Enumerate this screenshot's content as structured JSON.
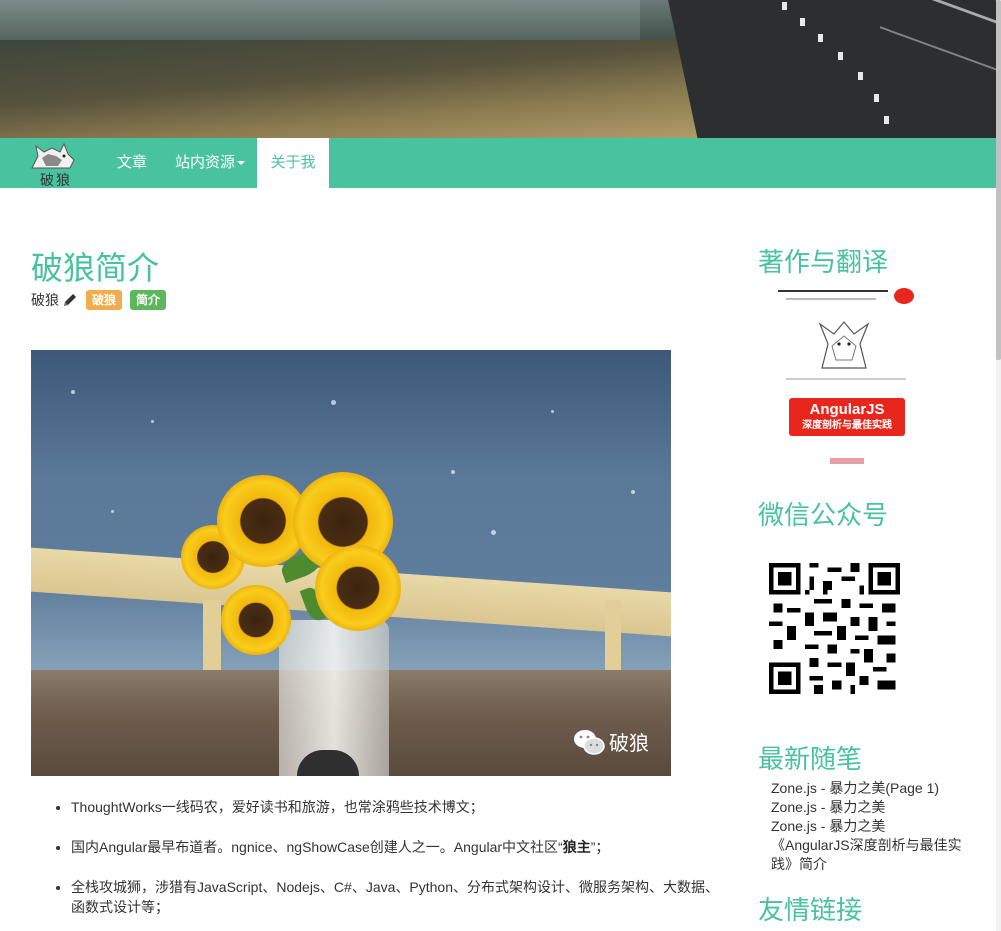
{
  "brand": {
    "logo_text": "破狼"
  },
  "nav": {
    "items": [
      {
        "label": "文章"
      },
      {
        "label": "站内资源",
        "has_dropdown": true
      },
      {
        "label": "关于我",
        "active": true
      }
    ]
  },
  "article": {
    "title": "破狼简介",
    "author": "破狼",
    "tags": [
      "破狼",
      "简介"
    ],
    "photo_watermark": "破狼",
    "bullets": [
      {
        "text_before": "ThoughtWorks一线码农，爱好读书和旅游，也常涂鸦些技术博文；",
        "bold": "",
        "text_after": ""
      },
      {
        "text_before": "国内Angular最早布道者。ngnice、ngShowCase创建人之一。Angular中文社区“",
        "bold": "狼主",
        "text_after": "”；"
      },
      {
        "text_before": "全栈攻城狮，涉猎有JavaScript、Nodejs、C#、Java、Python、分布式架构设计、微服务架构、大数据、函数式设计等；",
        "bold": "",
        "text_after": ""
      }
    ]
  },
  "sidebar": {
    "works_heading": "著作与翻译",
    "book_title": "AngularJS",
    "book_subtitle": "深度剖析与最佳实践",
    "wechat_heading": "微信公众号",
    "recent_heading": "最新随笔",
    "recent_posts": [
      "Zone.js - 暴力之美(Page 1)",
      "Zone.js - 暴力之美",
      "Zone.js - 暴力之美",
      "《AngularJS深度剖析与最佳实践》简介"
    ],
    "links_heading": "友情链接"
  },
  "colors": {
    "accent": "#48c29f",
    "tag_orange": "#f0ad4e",
    "tag_green": "#5cb85c",
    "book_red": "#e8261d"
  }
}
